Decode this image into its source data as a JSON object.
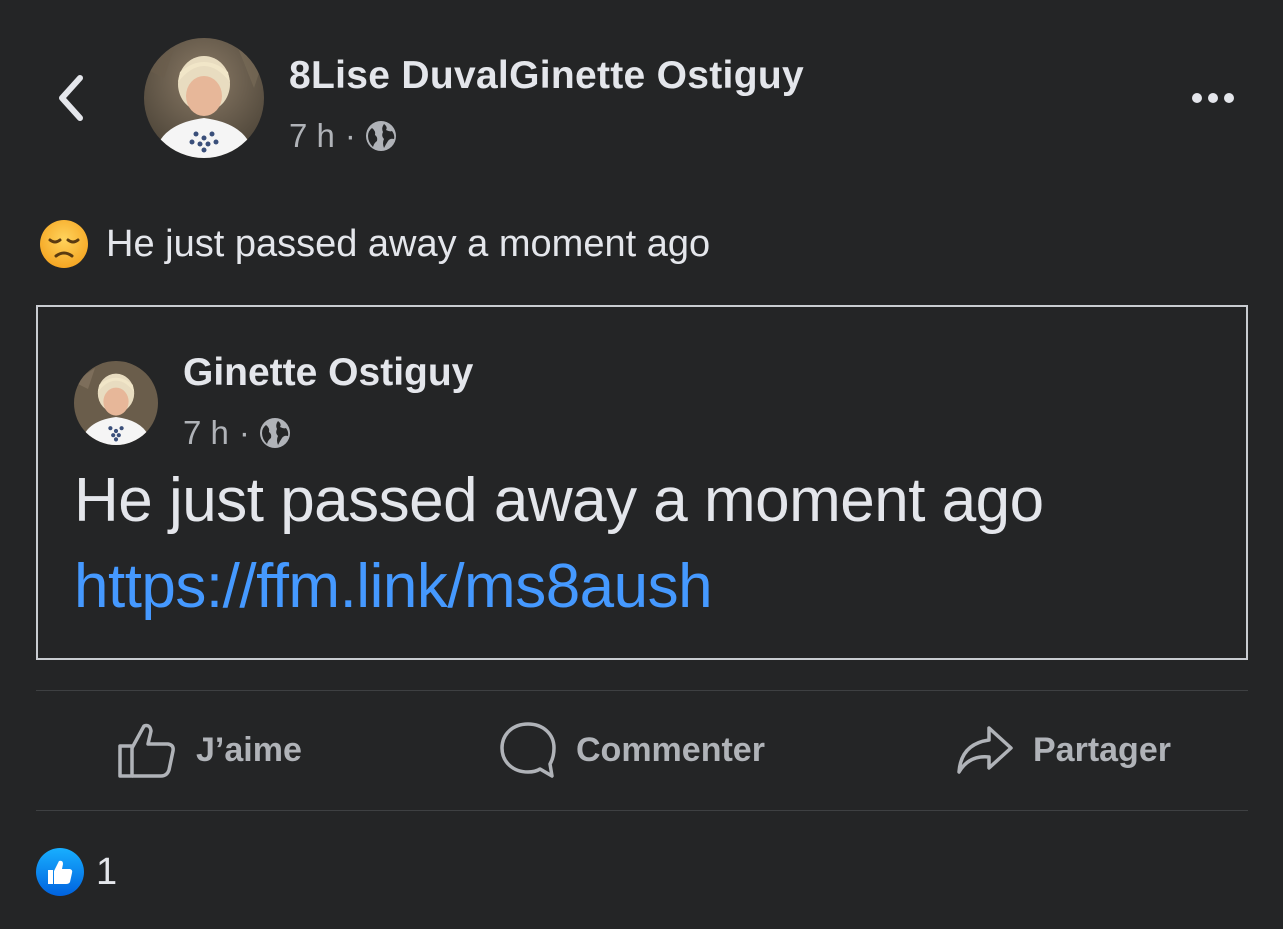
{
  "header": {
    "back_icon": "chevron-left-icon",
    "author_name": "8Lise DuvalGinette Ostiguy",
    "timestamp": "7 h",
    "separator": "·",
    "privacy_icon": "globe-icon",
    "more_icon": "ellipsis-icon"
  },
  "post": {
    "emoji_icon": "disappointed-face-emoji",
    "text": "He just passed away a moment ago"
  },
  "shared_post": {
    "author_name": "Ginette Ostiguy",
    "timestamp": "7 h",
    "separator": "·",
    "privacy_icon": "globe-icon",
    "text": "He just passed away a moment ago",
    "link": "https://ffm.link/ms8aush"
  },
  "actions": {
    "like_label": "J’aime",
    "comment_label": "Commenter",
    "share_label": "Partager"
  },
  "reactions": {
    "icon": "like-reaction-icon",
    "count": "1"
  },
  "colors": {
    "background": "#242526",
    "primary_text": "#e4e6eb",
    "secondary_text": "#b0b3b8",
    "link": "#4599ff",
    "like_blue": "#1877f2",
    "divider": "#3e4042"
  }
}
